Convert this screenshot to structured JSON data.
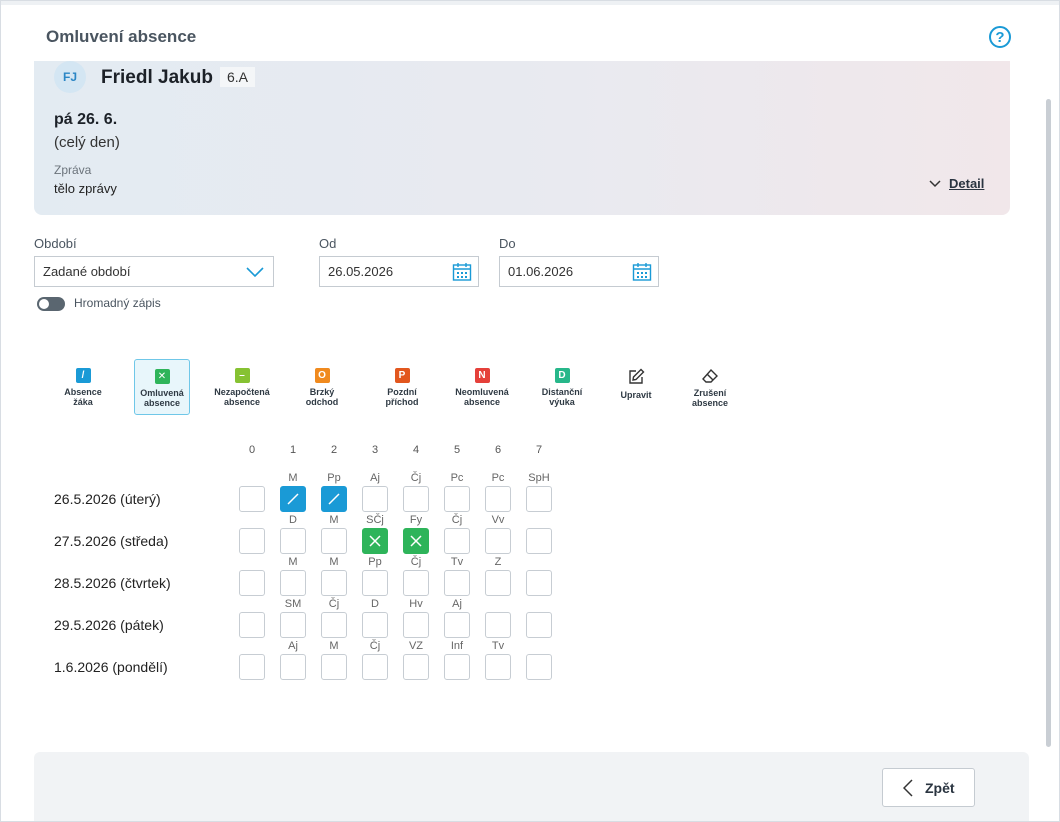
{
  "header": {
    "title": "Omluvení absence",
    "help_icon": "?"
  },
  "student": {
    "initials": "FJ",
    "name": "Friedl Jakub",
    "class": "6.A"
  },
  "absence": {
    "date": "pá 26. 6.",
    "range": "(celý den)",
    "message_label": "Zpráva",
    "message_body": "tělo zprávy",
    "detail_label": "Detail"
  },
  "filters": {
    "period_label": "Období",
    "period_value": "Zadané období",
    "from_label": "Od",
    "from_value": "26.05.2026",
    "to_label": "Do",
    "to_value": "01.06.2026"
  },
  "bulk": {
    "label": "Hromadný zápis",
    "enabled": false
  },
  "tools": [
    {
      "code": "absence-zaka",
      "line1": "Absence",
      "line2": "žáka",
      "glyph": "/",
      "color": "#1a9ad6"
    },
    {
      "code": "omluvena",
      "line1": "Omluvená",
      "line2": "absence",
      "glyph": "✕",
      "color": "#2eb45a",
      "selected": true
    },
    {
      "code": "nezapoctena",
      "line1": "Nezapočtená",
      "line2": "absence",
      "glyph": "–",
      "color": "#86c232"
    },
    {
      "code": "brzky",
      "line1": "Brzký",
      "line2": "odchod",
      "glyph": "O",
      "color": "#f08a1e"
    },
    {
      "code": "pozdni",
      "line1": "Pozdní",
      "line2": "příchod",
      "glyph": "P",
      "color": "#e2571e"
    },
    {
      "code": "neomluvena",
      "line1": "Neomluvená",
      "line2": "absence",
      "glyph": "N",
      "color": "#e5403a"
    },
    {
      "code": "distancni",
      "line1": "Distanční",
      "line2": "výuka",
      "glyph": "D",
      "color": "#27b78a"
    },
    {
      "code": "upravit",
      "line1": "Upravit",
      "line2": "",
      "glyph": "",
      "color": ""
    },
    {
      "code": "zruseni",
      "line1": "Zrušení",
      "line2": "absence",
      "glyph": "",
      "color": ""
    }
  ],
  "grid": {
    "columns": [
      "0",
      "1",
      "2",
      "3",
      "4",
      "5",
      "6",
      "7"
    ],
    "rows": [
      {
        "label": "26.5.2026 (úterý)",
        "subjects": [
          "",
          "M",
          "Pp",
          "Aj",
          "Čj",
          "Pc",
          "Pc",
          "SpH"
        ],
        "states": [
          "",
          "absence",
          "absence",
          "",
          "",
          "",
          "",
          ""
        ]
      },
      {
        "label": "27.5.2026 (středa)",
        "subjects": [
          "",
          "D",
          "M",
          "SČj",
          "Fy",
          "Čj",
          "Vv",
          ""
        ],
        "states": [
          "",
          "",
          "",
          "excused",
          "excused",
          "",
          "",
          ""
        ]
      },
      {
        "label": "28.5.2026 (čtvrtek)",
        "subjects": [
          "",
          "M",
          "M",
          "Pp",
          "Čj",
          "Tv",
          "Z",
          ""
        ],
        "states": [
          "",
          "",
          "",
          "",
          "",
          "",
          "",
          ""
        ]
      },
      {
        "label": "29.5.2026 (pátek)",
        "subjects": [
          "",
          "SM",
          "Čj",
          "D",
          "Hv",
          "Aj",
          "",
          ""
        ],
        "states": [
          "",
          "",
          "",
          "",
          "",
          "",
          "",
          ""
        ]
      },
      {
        "label": "1.6.2026 (pondělí)",
        "subjects": [
          "",
          "Aj",
          "M",
          "Čj",
          "VZ",
          "Inf",
          "Tv",
          ""
        ],
        "states": [
          "",
          "",
          "",
          "",
          "",
          "",
          "",
          ""
        ]
      }
    ]
  },
  "footer": {
    "back_label": "Zpět"
  },
  "colors": {
    "accent": "#1a9ad6",
    "absence": "#1a9ad6",
    "excused": "#2eb45a"
  }
}
